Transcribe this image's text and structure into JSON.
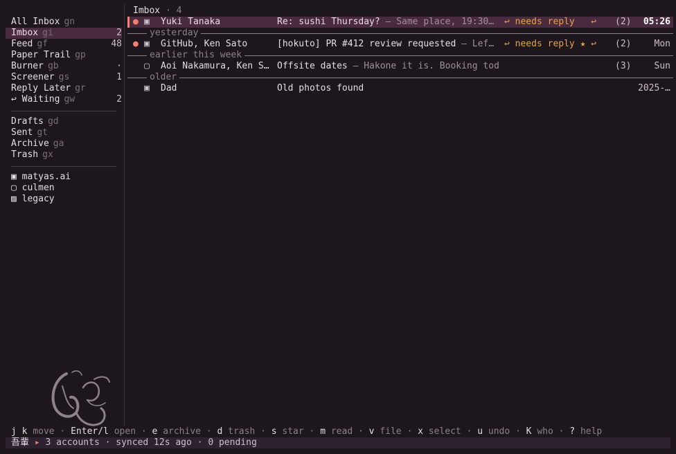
{
  "sidebar": {
    "mailboxes": [
      {
        "label": "All Inbox",
        "key": "gn",
        "count": ""
      },
      {
        "label": "Imbox",
        "key": "gi",
        "count": "2"
      },
      {
        "label": "Feed",
        "key": "gf",
        "count": "48"
      },
      {
        "label": "Paper Trail",
        "key": "gp",
        "count": ""
      },
      {
        "label": "Burner",
        "key": "gb",
        "count": "·"
      },
      {
        "label": "Screener",
        "key": "gs",
        "count": "1"
      },
      {
        "label": "Reply Later",
        "key": "gr",
        "count": ""
      },
      {
        "label": "↩ Waiting",
        "key": "gw",
        "count": "2"
      }
    ],
    "folders": [
      {
        "label": "Drafts",
        "key": "gd"
      },
      {
        "label": "Sent",
        "key": "gt"
      },
      {
        "label": "Archive",
        "key": "ga"
      },
      {
        "label": "Trash",
        "key": "gx"
      }
    ],
    "accounts": [
      {
        "icon": "▣",
        "name": "matyas.ai"
      },
      {
        "icon": "▢",
        "name": "culmen"
      },
      {
        "icon": "▨",
        "name": "legacy"
      }
    ]
  },
  "header": {
    "title": "Imbox",
    "sep": "·",
    "count": "4"
  },
  "groups": [
    "yesterday",
    "earlier this week",
    "older"
  ],
  "messages": [
    {
      "unread": "●",
      "account_icon": "▣",
      "from": "Yuki Tanaka",
      "subject": "Re: sushi Thursday?",
      "preview": " — Same place, 19:30…",
      "tag": "↩ needs reply",
      "star": "",
      "reply_mark": "↩",
      "thread_count": "(2)",
      "date": "05:26"
    },
    {
      "unread": "●",
      "account_icon": "▣",
      "from": "GitHub, Ken Sato",
      "subject": "[hokuto] PR #412 review requested",
      "preview": " — Lef…",
      "tag": "↩ needs reply",
      "star": "★",
      "reply_mark": "↩",
      "thread_count": "(2)",
      "date": "Mon"
    },
    {
      "unread": "",
      "account_icon": "▢",
      "from": "Aoi Nakamura, Ken S…",
      "subject": "Offsite dates",
      "preview": " — Hakone it is. Booking today.",
      "tag": "",
      "star": "",
      "reply_mark": "",
      "thread_count": "(3)",
      "date": "Sun"
    },
    {
      "unread": "",
      "account_icon": "▣",
      "from": "Dad",
      "subject": "Old photos found",
      "preview": "",
      "tag": "",
      "star": "",
      "reply_mark": "",
      "thread_count": "",
      "date": "2025-…"
    }
  ],
  "keybar": [
    {
      "k": "j k",
      "a": "move"
    },
    {
      "k": "Enter/l",
      "a": "open"
    },
    {
      "k": "e",
      "a": "archive"
    },
    {
      "k": "d",
      "a": "trash"
    },
    {
      "k": "s",
      "a": "star"
    },
    {
      "k": "m",
      "a": "read"
    },
    {
      "k": "v",
      "a": "file"
    },
    {
      "k": "x",
      "a": "select"
    },
    {
      "k": "u",
      "a": "undo"
    },
    {
      "k": "K",
      "a": "who"
    },
    {
      "k": "?",
      "a": "help"
    }
  ],
  "status": {
    "brand": "吾輩",
    "arrow": "▸",
    "accounts": "3 accounts",
    "synced": "synced 12s ago",
    "pending": "0 pending"
  },
  "colors": {
    "background": "#1d161c",
    "selection": "#4a2a3f",
    "accent_dot": "#f08070",
    "needs_reply": "#e8a24a"
  }
}
